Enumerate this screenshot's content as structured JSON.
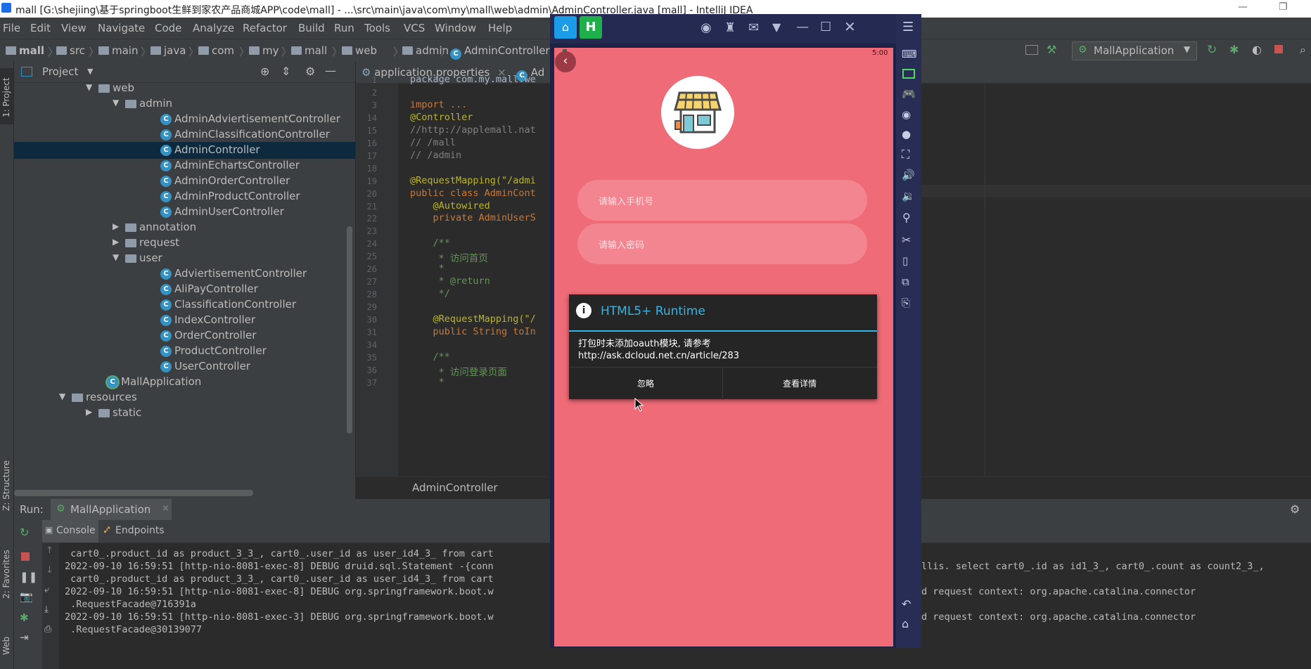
{
  "window": {
    "title": "mall [G:\\shejiing\\基于springboot生鲜到家农产品商城APP\\code\\mall] - ...\\src\\main\\java\\com\\my\\mall\\web\\admin\\AdminController.java [mall] - IntelliJ IDEA"
  },
  "menu": [
    "File",
    "Edit",
    "View",
    "Navigate",
    "Code",
    "Analyze",
    "Refactor",
    "Build",
    "Run",
    "Tools",
    "VCS",
    "Window",
    "Help"
  ],
  "breadcrumb": [
    "mall",
    "src",
    "main",
    "java",
    "com",
    "my",
    "mall",
    "web",
    "admin",
    "AdminController"
  ],
  "runconfig": "MallApplication",
  "left_stripe": {
    "project": "1: Project",
    "structure": "Z: Structure",
    "favorites": "2: Favorites",
    "web": "Web"
  },
  "project": {
    "header": "Project",
    "tree": [
      {
        "label": "web",
        "type": "folder",
        "indent": 0,
        "expanded": true
      },
      {
        "label": "admin",
        "type": "folder",
        "indent": 1,
        "expanded": true
      },
      {
        "label": "AdminAdviertisementController",
        "type": "class",
        "indent": 2
      },
      {
        "label": "AdminClassificationController",
        "type": "class",
        "indent": 2
      },
      {
        "label": "AdminController",
        "type": "class",
        "indent": 2,
        "selected": true
      },
      {
        "label": "AdminEchartsController",
        "type": "class",
        "indent": 2
      },
      {
        "label": "AdminOrderController",
        "type": "class",
        "indent": 2
      },
      {
        "label": "AdminProductController",
        "type": "class",
        "indent": 2
      },
      {
        "label": "AdminUserController",
        "type": "class",
        "indent": 2
      },
      {
        "label": "annotation",
        "type": "folder",
        "indent": 1,
        "expanded": false
      },
      {
        "label": "request",
        "type": "folder",
        "indent": 1,
        "expanded": false
      },
      {
        "label": "user",
        "type": "folder",
        "indent": 1,
        "expanded": true
      },
      {
        "label": "AdviertisementController",
        "type": "class",
        "indent": 2
      },
      {
        "label": "AliPayController",
        "type": "class",
        "indent": 2
      },
      {
        "label": "ClassificationController",
        "type": "class",
        "indent": 2
      },
      {
        "label": "IndexController",
        "type": "class",
        "indent": 2
      },
      {
        "label": "OrderController",
        "type": "class",
        "indent": 2
      },
      {
        "label": "ProductController",
        "type": "class",
        "indent": 2
      },
      {
        "label": "UserController",
        "type": "class",
        "indent": 2
      },
      {
        "label": "MallApplication",
        "type": "app",
        "indent": 0
      },
      {
        "label": "resources",
        "type": "folder",
        "indent": -1,
        "expanded": true
      },
      {
        "label": "static",
        "type": "folder",
        "indent": 0,
        "expanded": false
      }
    ]
  },
  "editor": {
    "tabs": [
      "application.properties",
      "Ad"
    ],
    "file_footer": "AdminController",
    "lines": [
      {
        "n": "1",
        "text": "package com.my.mall.we",
        "cls": ""
      },
      {
        "n": "2",
        "text": "",
        "cls": ""
      },
      {
        "n": "3",
        "text": "import ...",
        "cls": "kw"
      },
      {
        "n": "14",
        "text": "@Controller",
        "cls": "an"
      },
      {
        "n": "15",
        "text": "//http://applemall.nat",
        "cls": "cm"
      },
      {
        "n": "16",
        "text": "// /mall",
        "cls": "cm"
      },
      {
        "n": "17",
        "text": "// /admin",
        "cls": "cm"
      },
      {
        "n": "18",
        "text": "",
        "cls": ""
      },
      {
        "n": "19",
        "text": "@RequestMapping(\"/admi",
        "cls": "an"
      },
      {
        "n": "20",
        "text": "public class AdminCont",
        "cls": "kw"
      },
      {
        "n": "21",
        "text": "    @Autowired",
        "cls": "an"
      },
      {
        "n": "22",
        "text": "    private AdminUserS",
        "cls": "kw"
      },
      {
        "n": "23",
        "text": "",
        "cls": ""
      },
      {
        "n": "24",
        "text": "    /**",
        "cls": "dc"
      },
      {
        "n": "25",
        "text": "     * 访问首页",
        "cls": "dc"
      },
      {
        "n": "26",
        "text": "     *",
        "cls": "dc"
      },
      {
        "n": "27",
        "text": "     * @return",
        "cls": "dc"
      },
      {
        "n": "28",
        "text": "     */",
        "cls": "dc"
      },
      {
        "n": "29",
        "text": "",
        "cls": ""
      },
      {
        "n": "30",
        "text": "    @RequestMapping(\"/",
        "cls": "an"
      },
      {
        "n": "31",
        "text": "    public String toIn",
        "cls": "kw"
      },
      {
        "n": "34",
        "text": "",
        "cls": ""
      },
      {
        "n": "35",
        "text": "    /**",
        "cls": "dc"
      },
      {
        "n": "36",
        "text": "     * 访问登录页面",
        "cls": "dc"
      },
      {
        "n": "37",
        "text": "     *",
        "cls": "dc"
      }
    ]
  },
  "run": {
    "label": "Run:",
    "config_tab": "MallApplication",
    "tabs": [
      "Console",
      "Endpoints"
    ],
    "log_left": [
      " cart0_.product_id as product_3_3_, cart0_.user_id as user_id4_3_ from cart",
      "2022-09-10 16:59:51 [http-nio-8081-exec-8] DEBUG druid.sql.Statement -{conn",
      " cart0_.product_id as product_3_3_, cart0_.user_id as user_id4_3_ from cart",
      "2022-09-10 16:59:51 [http-nio-8081-exec-8] DEBUG org.springframework.boot.w",
      " .RequestFacade@716391a",
      "2022-09-10 16:59:51 [http-nio-8081-exec-3] DEBUG org.springframework.boot.w",
      " .RequestFacade@30139077"
    ],
    "log_right": [
      "",
      "llis. select cart0_.id as id1_3_, cart0_.count as count2_3_,",
      "",
      "d request context: org.apache.catalina.connector",
      "",
      "d request context: org.apache.catalina.connector",
      ""
    ]
  },
  "phone": {
    "status_time": "5:00",
    "phone_placeholder": "请输入手机号",
    "password_placeholder": "请输入密码",
    "dialog": {
      "title": "HTML5+ Runtime",
      "message_line1": "打包时未添加oauth模块, 请参考",
      "message_line2": "http://ask.dcloud.net.cn/article/283",
      "ignore_label": "忽略",
      "details_label": "查看详情"
    }
  },
  "colors": {
    "accent": "#33b5e5",
    "phone_bg": "#ef6b78",
    "ide_bg": "#2b2b2b",
    "panel_bg": "#3c3f41",
    "selection": "#0d293e"
  }
}
